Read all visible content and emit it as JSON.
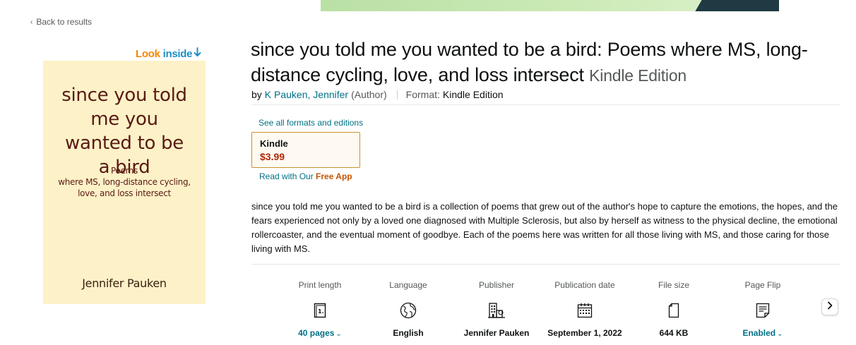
{
  "nav": {
    "back_link": "Back to results"
  },
  "look_inside": {
    "word1": "Look",
    "word2": "inside"
  },
  "cover": {
    "title": "since you told me you wanted to be a bird",
    "subtitle_line1": "Poems",
    "subtitle_line2": "where MS, long-distance cycling,",
    "subtitle_line3": "love, and loss intersect",
    "author": "Jennifer Pauken",
    "bg_color": "#fdf1c8"
  },
  "product": {
    "title": "since you told me you wanted to be a bird: Poems where MS, long-distance cycling, love, and loss intersect",
    "edition": "Kindle Edition",
    "by_label": "by",
    "author": "K Pauken, Jennifer",
    "author_role": "(Author)",
    "format_label": "Format:",
    "format_value": "Kindle Edition"
  },
  "formats": {
    "see_all": "See all formats and editions",
    "selected": {
      "name": "Kindle",
      "price": "$3.99"
    },
    "read_app_prefix": "Read with Our",
    "read_app_free": "Free App"
  },
  "description": "since you told me you wanted to be a bird is a collection of poems that grew out of the author's hope to capture the emotions, the hopes, and the fears experienced not only by a loved one diagnosed with Multiple Sclerosis, but also by herself as witness to the physical decline, the emotional rollercoaster, and the eventual moment of goodbye. Each of the poems here was written for all those living with MS, and those caring for those living with MS.",
  "details": [
    {
      "label": "Print length",
      "value": "40 pages",
      "icon": "book-pages-icon",
      "link": true
    },
    {
      "label": "Language",
      "value": "English",
      "icon": "globe-icon",
      "link": false
    },
    {
      "label": "Publisher",
      "value": "Jennifer Pauken",
      "icon": "building-icon",
      "link": false
    },
    {
      "label": "Publication date",
      "value": "September 1, 2022",
      "icon": "calendar-icon",
      "link": false
    },
    {
      "label": "File size",
      "value": "644 KB",
      "icon": "file-icon",
      "link": false
    },
    {
      "label": "Page Flip",
      "value": "Enabled",
      "icon": "page-flip-icon",
      "link": true
    }
  ],
  "colors": {
    "link": "#007185",
    "price": "#b12704",
    "look_orange": "#f08804",
    "look_blue": "#1e8fc6",
    "selected_border": "#c7922c"
  }
}
